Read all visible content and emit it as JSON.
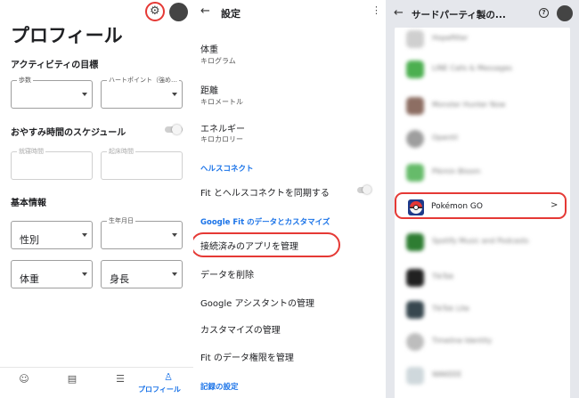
{
  "profile": {
    "title": "プロフィール",
    "activity_goals_label": "アクティビティの目標",
    "steps_label": "歩数",
    "heart_points_label": "ハートポイント（強め…",
    "sleep_schedule_label": "おやすみ時間のスケジュール",
    "bedtime_label": "就寝時間",
    "wake_time_label": "起床時間",
    "basic_info_label": "基本情報",
    "gender_value": "性別",
    "birthday_label": "生年月日",
    "weight_value": "体重",
    "height_value": "身長",
    "nav_active_label": "プロフィール"
  },
  "settings": {
    "title": "設定",
    "weight_title": "体重",
    "weight_sub": "キログラム",
    "distance_title": "距離",
    "distance_sub": "キロメートル",
    "energy_title": "エネルギー",
    "energy_sub": "キロカロリー",
    "health_connect_header": "ヘルスコネクト",
    "sync_label": "Fit とヘルスコネクトを同期する",
    "customize_header": "Google Fit のデータとカスタマイズ",
    "manage_apps": "接続済みのアプリを管理",
    "delete_data": "データを削除",
    "assistant_manage": "Google アシスタントの管理",
    "customize_manage": "カスタマイズの管理",
    "fit_permissions": "Fit のデータ権限を管理",
    "record_settings_header": "記録の設定"
  },
  "third_party": {
    "title": "サードパーティ製の...",
    "help_icon": "?",
    "highlighted_app": "Pokémon GO",
    "blurred_apps": [
      "Hopefitter",
      "LINE Calls & Messages",
      "Monster Hunter Now",
      "Opentil",
      "Pikmin Bloom",
      "Spotify Music and Podcasts",
      "TikTok",
      "TikTok Lite",
      "Timeline Identity",
      "WAKEEE"
    ]
  },
  "colors": {
    "accent": "#1a73e8",
    "highlight": "#e53935",
    "panel3_bg": "#e5e7ec"
  }
}
